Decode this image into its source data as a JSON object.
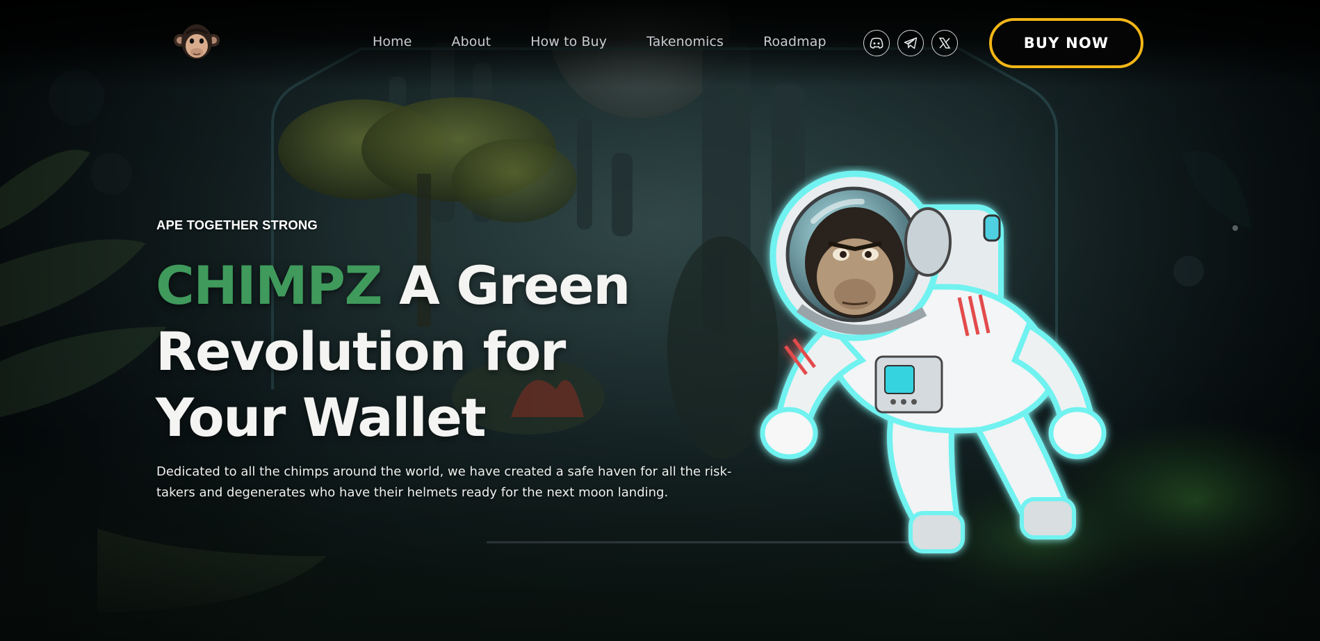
{
  "header": {
    "nav": [
      "Home",
      "About",
      "How to Buy",
      "Takenomics",
      "Roadmap"
    ],
    "socials": [
      "discord-icon",
      "telegram-icon",
      "x-icon"
    ],
    "buy_label": "BUY NOW"
  },
  "hero": {
    "eyebrow": "APE TOGETHER STRONG",
    "headline_accent": "CHIMPZ",
    "headline_rest": "A Green Revolution for Your Wallet",
    "description": "Dedicated to all the chimps around the world, we have created a safe haven for all the risk-takers and degenerates who have their helmets ready for the next moon landing."
  },
  "colors": {
    "accent_green": "#3f9a5c",
    "button_border": "#f3b617",
    "glow": "#6ff2f0"
  }
}
